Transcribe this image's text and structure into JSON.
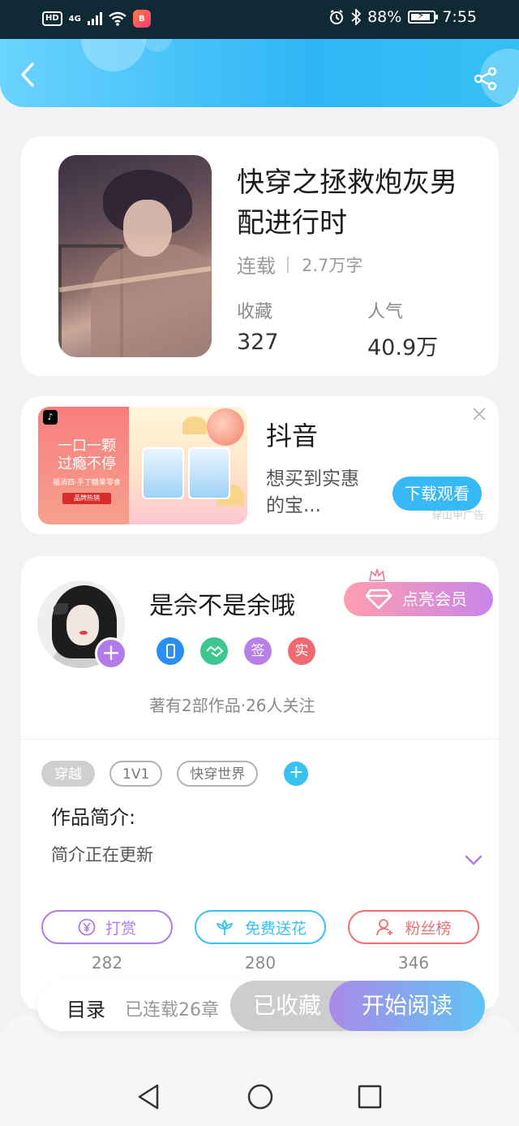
{
  "status_bar": {
    "hd": "HD",
    "signal": "4G",
    "app_badge": "B",
    "battery": "88%",
    "battery_level": 0.88,
    "time": "7:55"
  },
  "header": {
    "back_icon": "chevron-left-icon",
    "share_icon": "share-icon"
  },
  "book": {
    "title": "快穿之拯救炮灰男配进行时",
    "status": "连载",
    "word_count": "2.7万字",
    "favorites_label": "收藏",
    "favorites_value": "327",
    "popularity_label": "人气",
    "popularity_value": "40.9万"
  },
  "ad": {
    "image_line1": "一口一颗\n过瘾不停",
    "image_line2": "福消四·手丁糖果零食",
    "image_tag": "品牌热销",
    "app_name": "抖音",
    "description": "想买到实惠的宝...",
    "button": "下载观看",
    "source": "穿山甲广告"
  },
  "author": {
    "name": "是佘不是余哦",
    "vip_button": "点亮会员",
    "badges": [
      {
        "text": "",
        "color": "#2b8ff0",
        "icon": "phone-medal-icon"
      },
      {
        "text": "",
        "color": "#3cc690",
        "icon": "handshake-medal-icon"
      },
      {
        "text": "签",
        "color": "#b680e6",
        "icon": "sign-badge-icon"
      },
      {
        "text": "实",
        "color": "#f06a72",
        "icon": "verified-badge-icon"
      }
    ],
    "works_info": "著有2部作品·26人关注"
  },
  "tags": [
    "穿越",
    "1V1",
    "快穿世界"
  ],
  "intro": {
    "heading": "作品简介:",
    "text": "简介正在更新"
  },
  "actions": [
    {
      "label": "打赏",
      "count": "282",
      "color": "#b27be8",
      "icon": "yen-icon"
    },
    {
      "label": "免费送花",
      "count": "280",
      "color": "#38c2f2",
      "icon": "flower-icon"
    },
    {
      "label": "粉丝榜",
      "count": "346",
      "color": "#ef6f74",
      "icon": "fan-icon"
    }
  ],
  "read_bar": {
    "toc": "目录",
    "serial": "已连载26章",
    "collected": "已收藏",
    "start": "开始阅读"
  },
  "colors": {
    "header_start": "#6ad3ff",
    "header_end": "#2fb6f5",
    "accent_purple": "#b27be8"
  }
}
